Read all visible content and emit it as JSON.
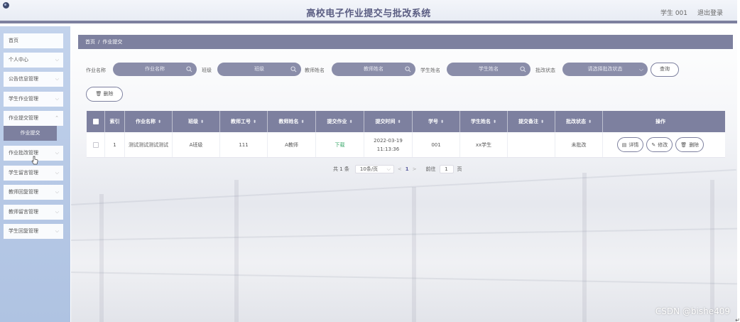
{
  "header": {
    "title": "高校电子作业提交与批改系统",
    "user": "学生 001",
    "logout": "退出登录"
  },
  "sidebar": {
    "items": [
      {
        "label": "首页",
        "has_arrow": false
      },
      {
        "label": "个人中心",
        "has_arrow": true
      },
      {
        "label": "公告信息管理",
        "has_arrow": true
      },
      {
        "label": "学生作业管理",
        "has_arrow": true
      },
      {
        "label": "作业提交管理",
        "has_arrow": true
      },
      {
        "label": "作业批改管理",
        "has_arrow": true
      },
      {
        "label": "学生留言管理",
        "has_arrow": true
      },
      {
        "label": "教师回复管理",
        "has_arrow": true
      },
      {
        "label": "教师留言管理",
        "has_arrow": true
      },
      {
        "label": "学生回复管理",
        "has_arrow": true
      }
    ],
    "active_submenu": "作业提交"
  },
  "breadcrumb": {
    "home": "首页",
    "separator": "/",
    "current": "作业提交"
  },
  "search": {
    "fields": [
      {
        "label": "作业名称",
        "placeholder": "作业名称"
      },
      {
        "label": "班级",
        "placeholder": "班级"
      },
      {
        "label": "教师姓名",
        "placeholder": "教师姓名"
      },
      {
        "label": "学生姓名",
        "placeholder": "学生姓名"
      },
      {
        "label": "批改状态",
        "placeholder": "请选择批改状态"
      }
    ],
    "query_button": "查询",
    "delete_button": "删除"
  },
  "table": {
    "columns": [
      "索引",
      "作业名称",
      "班级",
      "教师工号",
      "教师姓名",
      "提交作业",
      "提交时间",
      "学号",
      "学生姓名",
      "提交备注",
      "批改状态",
      "操作"
    ],
    "rows": [
      {
        "index": "1",
        "assignment_name": "测试测试测试测试",
        "class": "A班级",
        "teacher_id": "111",
        "teacher_name": "A教师",
        "submission": "下载",
        "submit_time": "2022-03-19 11:13:36",
        "student_id": "001",
        "student_name": "xx学生",
        "remark": "",
        "status": "未批改"
      }
    ],
    "actions": {
      "detail": "详情",
      "edit": "修改",
      "delete": "删除"
    }
  },
  "pagination": {
    "total": "共 1 条",
    "page_size": "10条/页",
    "prev": "<",
    "current_page": "1",
    "next": ">",
    "goto_label": "前往",
    "goto_value": "1",
    "page_unit": "页"
  },
  "watermark": "CSDN @bishe409",
  "colors": {
    "primary": "#7d809f",
    "sidebar_bg": "#b7c9e6",
    "download_link": "#3aa86b"
  }
}
